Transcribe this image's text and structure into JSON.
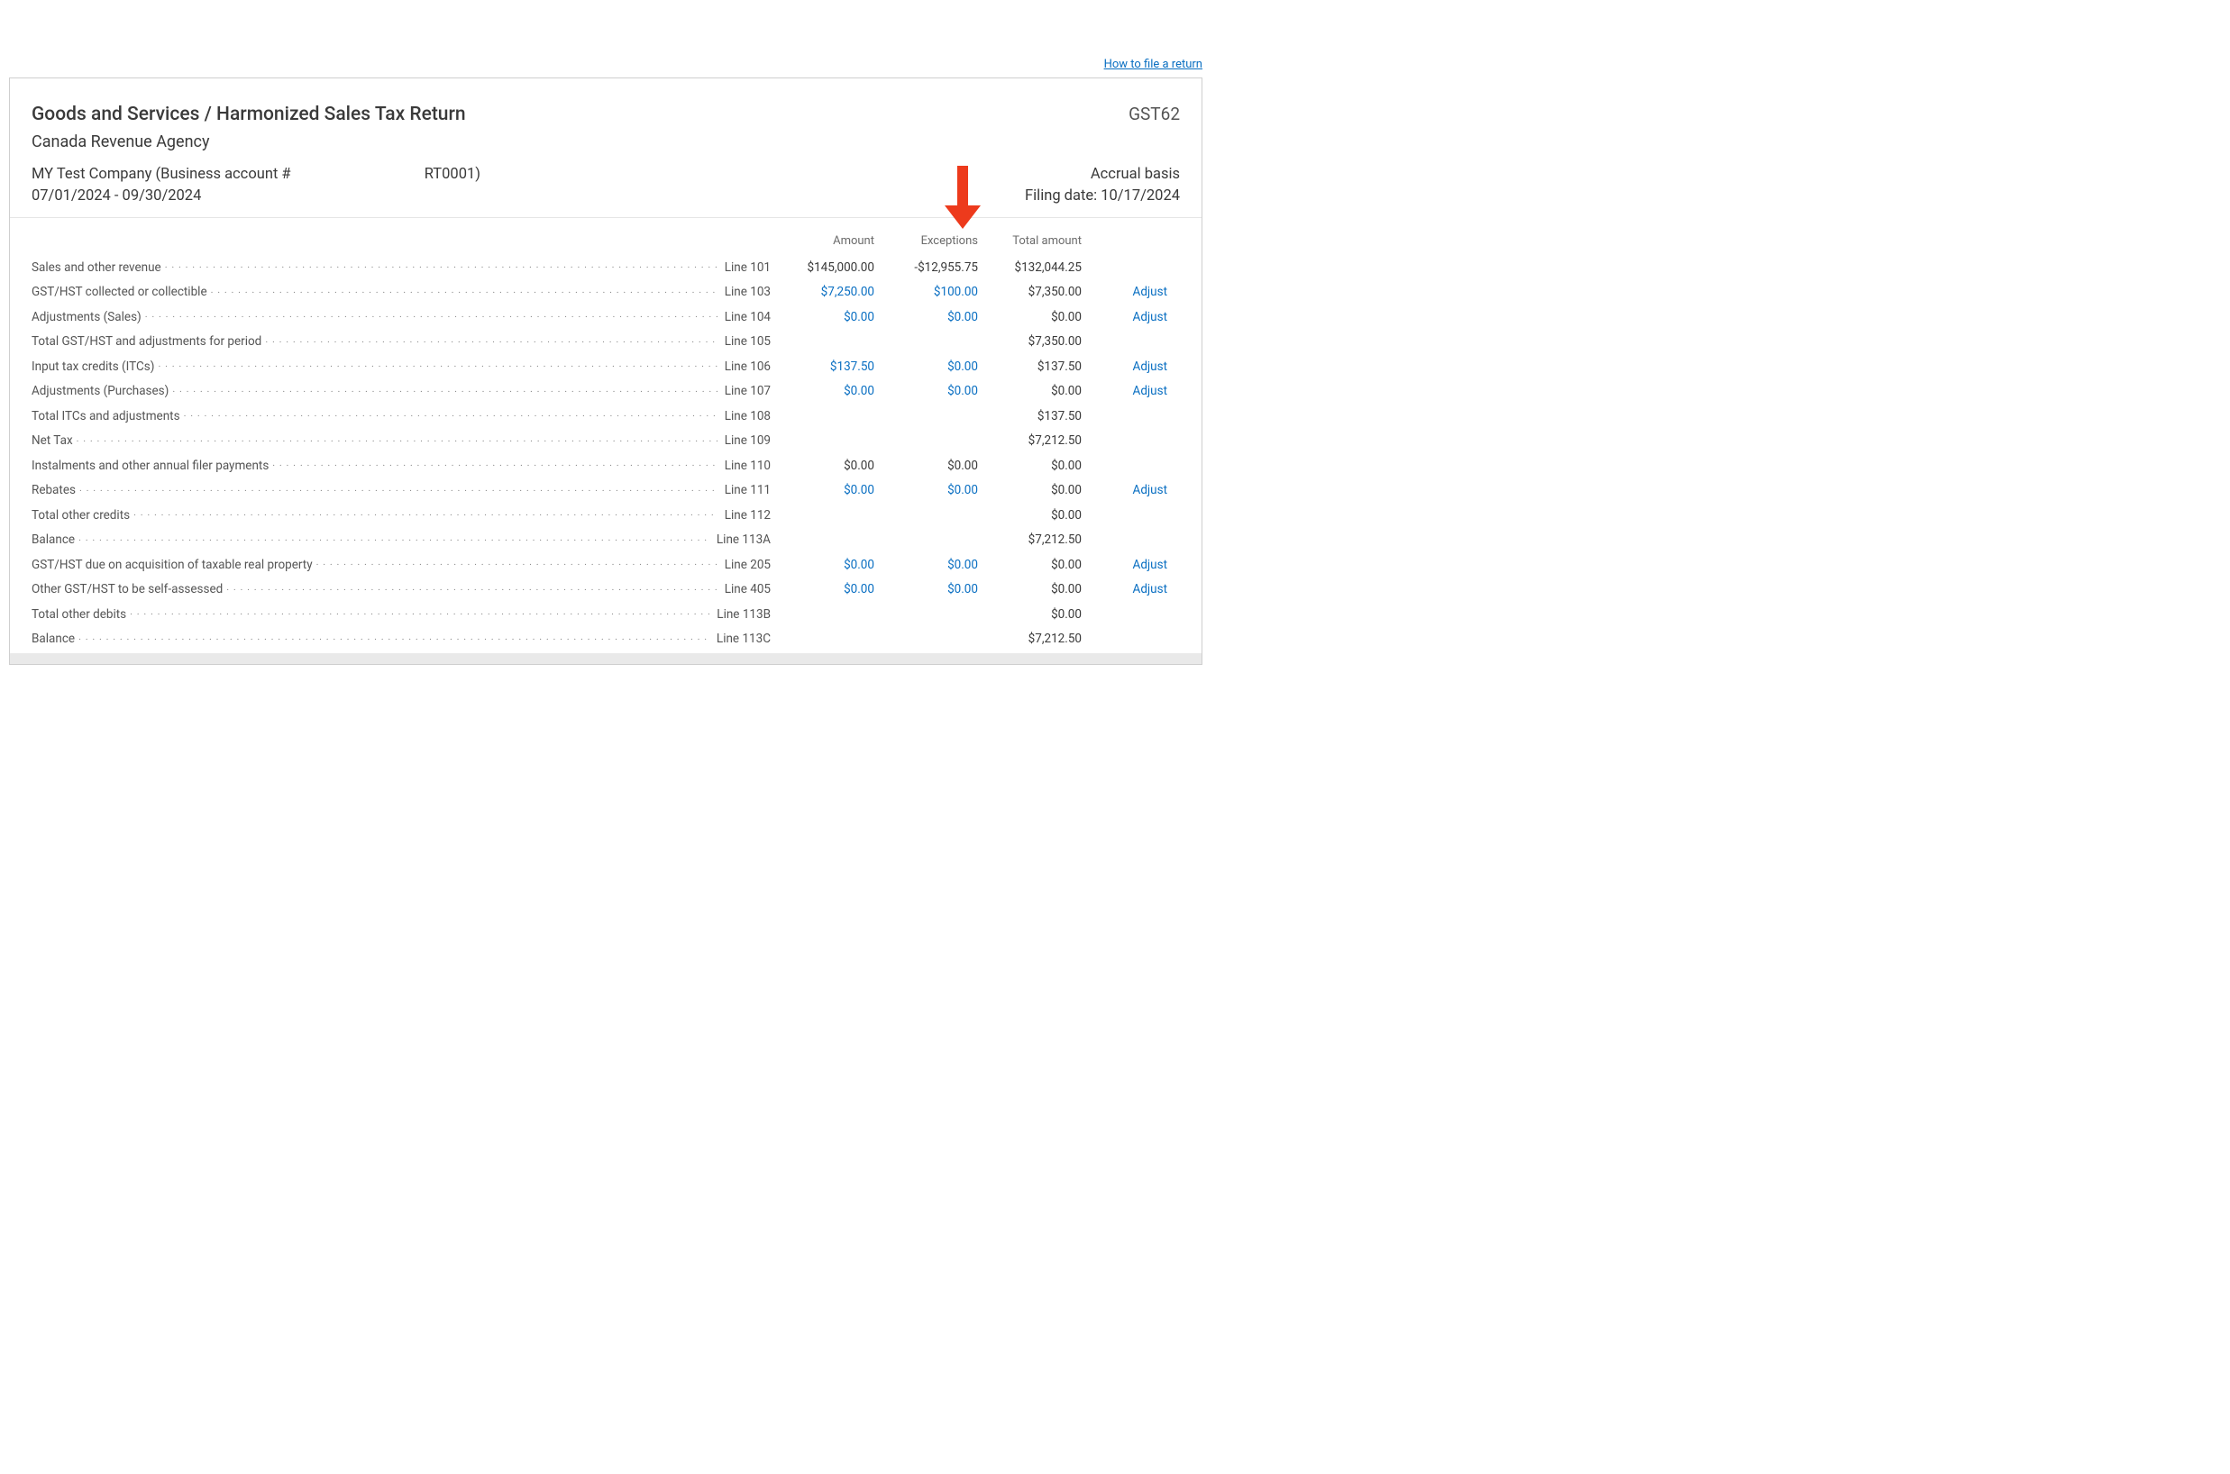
{
  "help_link": "How to file a return",
  "header": {
    "title": "Goods and Services / Harmonized Sales Tax Return",
    "form_code": "GST62",
    "agency": "Canada Revenue Agency",
    "company": "MY Test Company (Business account #",
    "company_suffix": "RT0001)",
    "period": "07/01/2024 - 09/30/2024",
    "basis": "Accrual basis",
    "filing_date_label": "Filing date: 10/17/2024"
  },
  "columns": {
    "amount": "Amount",
    "exceptions": "Exceptions",
    "total": "Total amount"
  },
  "lines": [
    {
      "label": "Sales and other revenue",
      "line": "Line 101",
      "amount": "$145,000.00",
      "amount_link": false,
      "exceptions": "-$12,955.75",
      "exceptions_link": false,
      "total": "$132,044.25",
      "adjust": false
    },
    {
      "label": "GST/HST collected or collectible",
      "line": "Line 103",
      "amount": "$7,250.00",
      "amount_link": true,
      "exceptions": "$100.00",
      "exceptions_link": true,
      "total": "$7,350.00",
      "adjust": true
    },
    {
      "label": "Adjustments (Sales)",
      "line": "Line 104",
      "amount": "$0.00",
      "amount_link": true,
      "exceptions": "$0.00",
      "exceptions_link": true,
      "total": "$0.00",
      "adjust": true
    },
    {
      "label": "Total GST/HST and adjustments for period",
      "line": "Line 105",
      "amount": "",
      "amount_link": false,
      "exceptions": "",
      "exceptions_link": false,
      "total": "$7,350.00",
      "adjust": false
    },
    {
      "label": "Input tax credits (ITCs)",
      "line": "Line 106",
      "amount": "$137.50",
      "amount_link": true,
      "exceptions": "$0.00",
      "exceptions_link": true,
      "total": "$137.50",
      "adjust": true
    },
    {
      "label": "Adjustments (Purchases)",
      "line": "Line 107",
      "amount": "$0.00",
      "amount_link": true,
      "exceptions": "$0.00",
      "exceptions_link": true,
      "total": "$0.00",
      "adjust": true
    },
    {
      "label": "Total ITCs and adjustments",
      "line": "Line 108",
      "amount": "",
      "amount_link": false,
      "exceptions": "",
      "exceptions_link": false,
      "total": "$137.50",
      "adjust": false
    },
    {
      "label": "Net Tax",
      "line": "Line 109",
      "amount": "",
      "amount_link": false,
      "exceptions": "",
      "exceptions_link": false,
      "total": "$7,212.50",
      "adjust": false
    },
    {
      "label": "Instalments and other annual filer payments",
      "line": "Line 110",
      "amount": "$0.00",
      "amount_link": false,
      "exceptions": "$0.00",
      "exceptions_link": false,
      "total": "$0.00",
      "adjust": false
    },
    {
      "label": "Rebates",
      "line": "Line 111",
      "amount": "$0.00",
      "amount_link": true,
      "exceptions": "$0.00",
      "exceptions_link": true,
      "total": "$0.00",
      "adjust": true
    },
    {
      "label": "Total other credits",
      "line": "Line 112",
      "amount": "",
      "amount_link": false,
      "exceptions": "",
      "exceptions_link": false,
      "total": "$0.00",
      "adjust": false
    },
    {
      "label": "Balance",
      "line": "Line 113A",
      "amount": "",
      "amount_link": false,
      "exceptions": "",
      "exceptions_link": false,
      "total": "$7,212.50",
      "adjust": false
    },
    {
      "label": "GST/HST due on acquisition of taxable real property",
      "line": "Line 205",
      "amount": "$0.00",
      "amount_link": true,
      "exceptions": "$0.00",
      "exceptions_link": true,
      "total": "$0.00",
      "adjust": true
    },
    {
      "label": "Other GST/HST to be self-assessed",
      "line": "Line 405",
      "amount": "$0.00",
      "amount_link": true,
      "exceptions": "$0.00",
      "exceptions_link": true,
      "total": "$0.00",
      "adjust": true
    },
    {
      "label": "Total other debits",
      "line": "Line 113B",
      "amount": "",
      "amount_link": false,
      "exceptions": "",
      "exceptions_link": false,
      "total": "$0.00",
      "adjust": false
    },
    {
      "label": "Balance",
      "line": "Line 113C",
      "amount": "",
      "amount_link": false,
      "exceptions": "",
      "exceptions_link": false,
      "total": "$7,212.50",
      "adjust": false
    }
  ],
  "adjust_label": "Adjust"
}
